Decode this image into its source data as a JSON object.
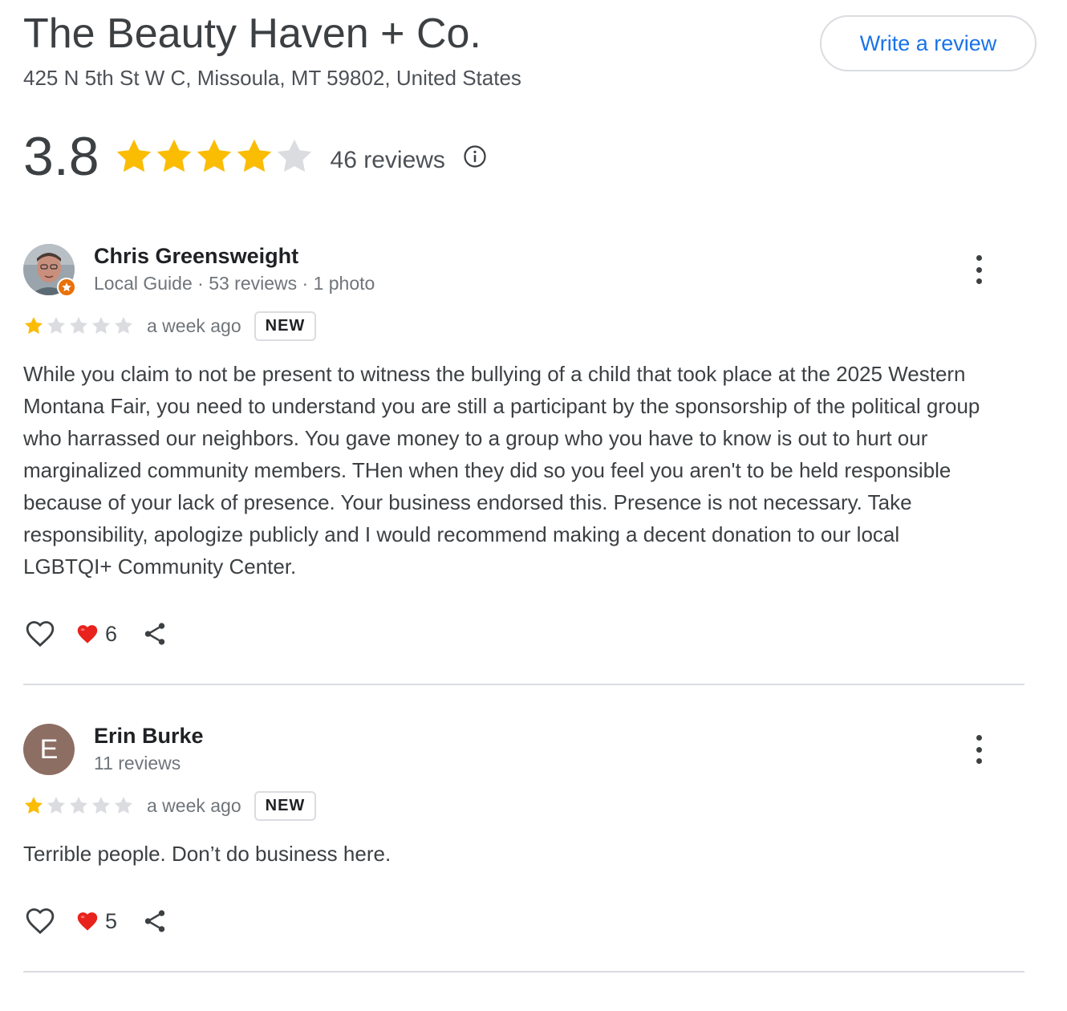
{
  "business": {
    "name": "The Beauty Haven + Co.",
    "address": "425 N 5th St W C, Missoula, MT 59802, United States",
    "write_review_label": "Write a review",
    "rating": "3.8",
    "rating_stars_filled": 4,
    "rating_stars_total": 5,
    "review_count_label": "46 reviews",
    "star_color": "#fbbc04",
    "star_empty_color": "#dadce0"
  },
  "reviews": [
    {
      "name": "Chris Greensweight",
      "meta": "Local Guide · 53 reviews · 1 photo",
      "stars": 1,
      "date": "a week ago",
      "badge": "NEW",
      "text": "While you claim to not be present to witness the bullying of a child that took place at the 2025 Western Montana Fair, you need to understand you are still a participant by the sponsorship of the political group who harrassed our neighbors. You gave money to a group who you have to know is out to hurt our marginalized community members. THen when they did so you feel you aren't to be held responsible because of your lack of presence. Your business endorsed this. Presence is not necessary. Take responsibility, apologize publicly and I would recommend making a decent donation to our local LGBTQI+ Community Center.",
      "hearts": "6",
      "avatar_type": "photo"
    },
    {
      "name": "Erin Burke",
      "meta": "11 reviews",
      "stars": 1,
      "date": "a week ago",
      "badge": "NEW",
      "text": "Terrible people. Don’t do business here.",
      "hearts": "5",
      "avatar_type": "letter",
      "avatar_letter": "E",
      "avatar_color": "#8d6e63"
    }
  ]
}
